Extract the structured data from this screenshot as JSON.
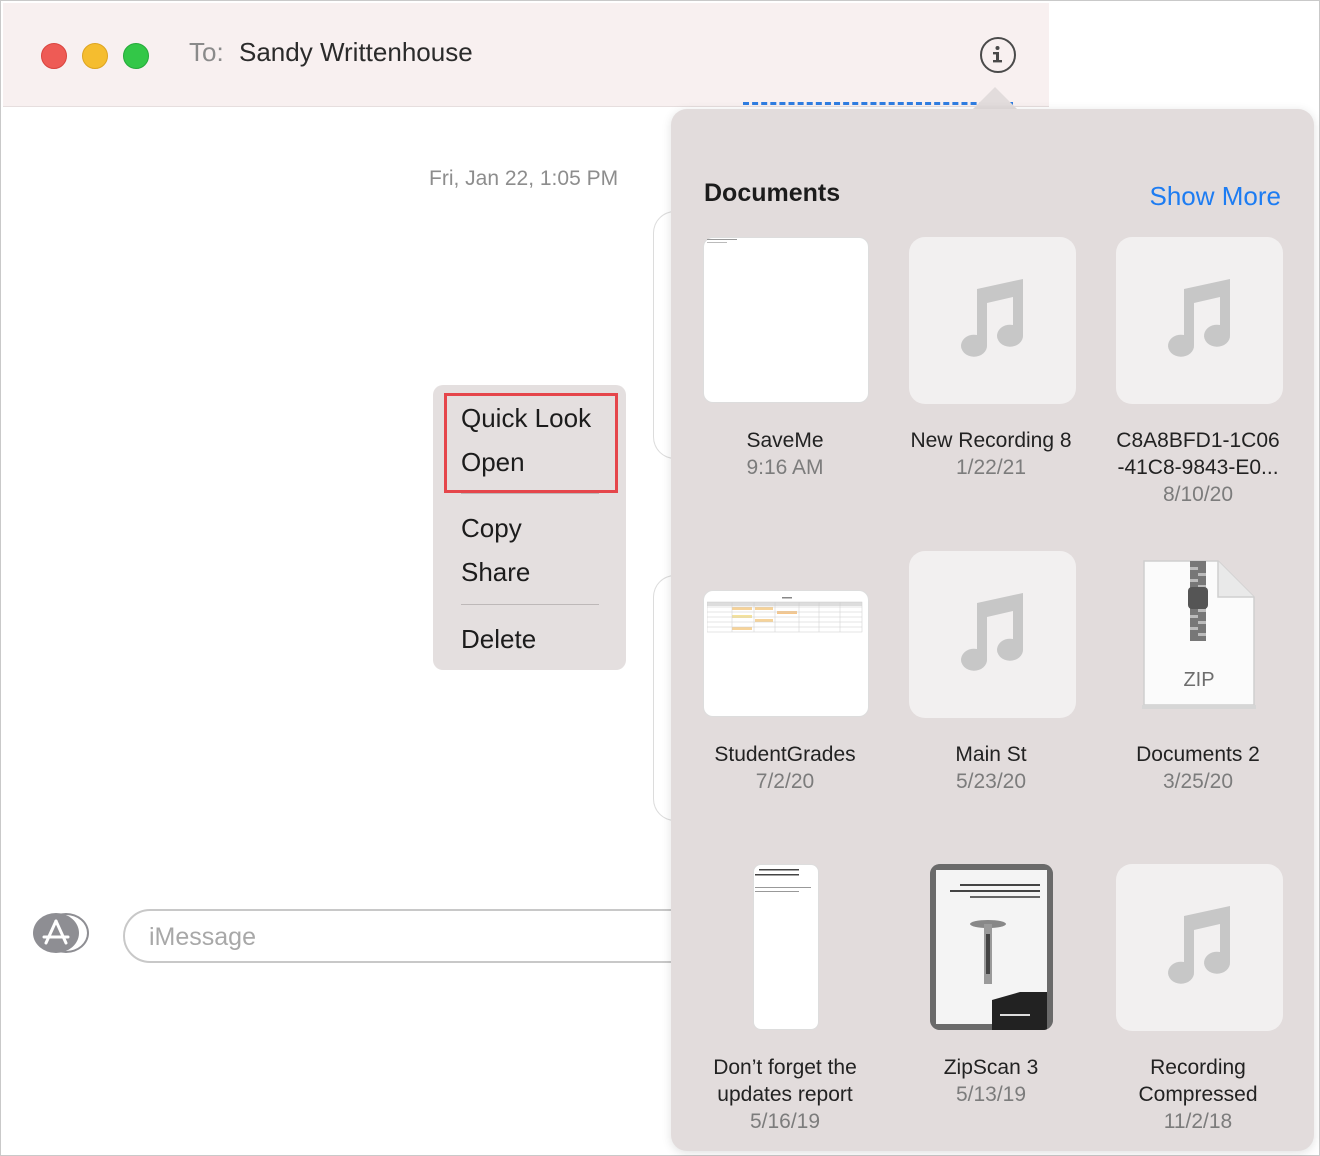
{
  "window": {
    "to_label": "To:",
    "recipient": "Sandy Writtenhouse"
  },
  "conversation": {
    "timestamp": "Fri, Jan 22, 1:05 PM"
  },
  "context_menu": {
    "items": [
      "Quick Look",
      "Open",
      "Copy",
      "Share",
      "Delete"
    ]
  },
  "compose": {
    "placeholder": "iMessage"
  },
  "documents": {
    "title": "Documents",
    "show_more": "Show More",
    "items": [
      {
        "name": "SaveMe",
        "date": "9:16 AM",
        "thumb": "document-thumbnail"
      },
      {
        "name": "New Recording 8",
        "date": "1/22/21",
        "thumb": "music-note-icon"
      },
      {
        "name": "C8A8BFD1-1C06",
        "name2": "-41C8-9843-E0...",
        "date": "8/10/20",
        "thumb": "music-note-icon"
      },
      {
        "name": "StudentGrades",
        "date": "7/2/20",
        "thumb": "spreadsheet-thumbnail"
      },
      {
        "name": "Main St",
        "date": "5/23/20",
        "thumb": "music-note-icon"
      },
      {
        "name": "Documents 2",
        "date": "3/25/20",
        "thumb": "zip-archive-icon",
        "label": "ZIP"
      },
      {
        "name": "Don’t forget the",
        "name2": "updates report",
        "date": "5/16/19",
        "thumb": "document-thumbnail"
      },
      {
        "name": "ZipScan 3",
        "date": "5/13/19",
        "thumb": "scan-thumbnail"
      },
      {
        "name": "Recording",
        "name2": "Compressed",
        "date": "11/2/18",
        "thumb": "music-note-icon"
      }
    ]
  },
  "colors": {
    "close": "#ee5b55",
    "minimize": "#f5bd2f",
    "zoom": "#33c748",
    "accent": "#1d7cf2",
    "highlight": "#e5464b"
  }
}
